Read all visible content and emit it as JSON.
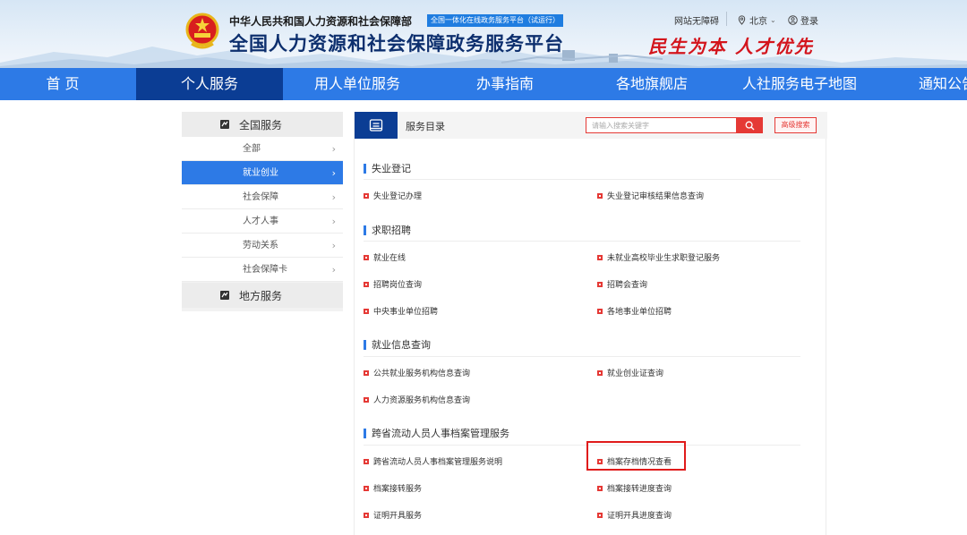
{
  "header": {
    "ministry": "中华人民共和国人力资源和社会保障部",
    "badge": "全国一体化在线政务服务平台（试运行）",
    "title": "全国人力资源和社会保障政务服务平台",
    "slogan": "民生为本 人才优先",
    "accessibility": "网站无障碍",
    "city": "北京",
    "login": "登录",
    "icons": {
      "emblem": "national-emblem",
      "city": "location-pin-icon",
      "login": "user-icon"
    }
  },
  "nav": {
    "items": [
      "首 页",
      "个人服务",
      "用人单位服务",
      "办事指南",
      "各地旗舰店",
      "人社服务电子地图",
      "通知公告"
    ],
    "active_index": 1
  },
  "sidebar": {
    "national_label": "全国服务",
    "local_label": "地方服务",
    "items": [
      "全部",
      "就业创业",
      "社会保障",
      "人才人事",
      "劳动关系",
      "社会保障卡"
    ],
    "active_index": 1
  },
  "panel": {
    "title": "服务目录",
    "search_placeholder": "请输入搜索关键字",
    "advanced_search": "高级搜索",
    "sections": [
      {
        "title": "失业登记",
        "links": [
          "失业登记办理",
          "失业登记审核结果信息查询"
        ]
      },
      {
        "title": "求职招聘",
        "links": [
          "就业在线",
          "未就业高校毕业生求职登记服务",
          "招聘岗位查询",
          "招聘会查询",
          "中央事业单位招聘",
          "各地事业单位招聘"
        ]
      },
      {
        "title": "就业信息查询",
        "links": [
          "公共就业服务机构信息查询",
          "就业创业证查询",
          "人力资源服务机构信息查询"
        ]
      },
      {
        "title": "跨省流动人员人事档案管理服务",
        "links": [
          "跨省流动人员人事档案管理服务说明",
          "档案存档情况查看",
          "档案接转服务",
          "档案接转进度查询",
          "证明开具服务",
          "证明开具进度查询"
        ]
      }
    ],
    "highlighted_link": "档案存档情况查看"
  },
  "colors": {
    "nav_blue": "#2d7ae6",
    "active_navy": "#0b3d94",
    "accent_red": "#e53935",
    "slogan_red": "#d3141c"
  }
}
